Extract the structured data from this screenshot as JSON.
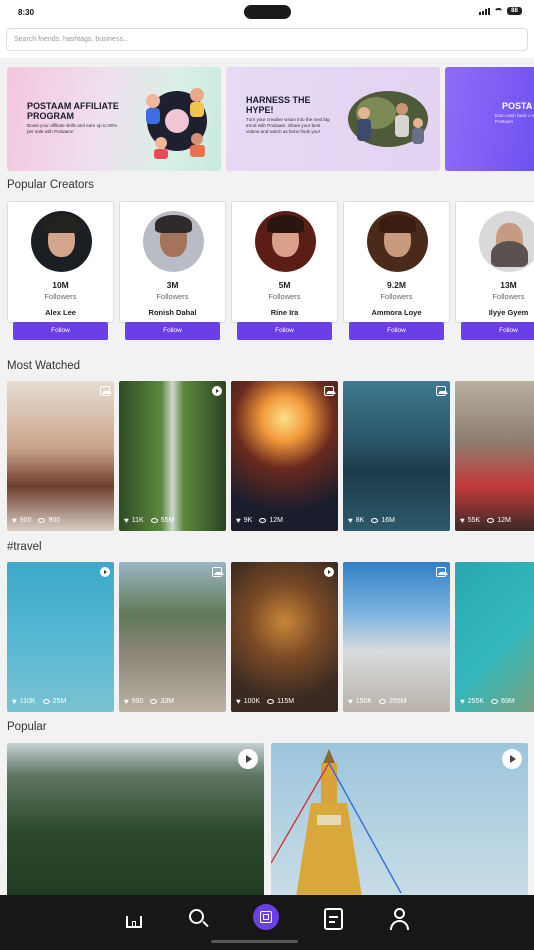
{
  "status": {
    "time": "8:30",
    "battery": "88"
  },
  "search": {
    "placeholder": "Search friends, hashtags, business..."
  },
  "banners": [
    {
      "title": "POSTAAM AFFILIATE PROGRAM",
      "desc": "Boost your affiliate skills and earn up to 80% per sale with Postaam!"
    },
    {
      "title": "HARNESS THE HYPE!",
      "desc": "Turn your creative vision into the next big trend with Postaam. Share your best videos and watch as fame finds you!"
    },
    {
      "title": "POSTA",
      "desc": "Earn cash back o with Postaam"
    }
  ],
  "sections": {
    "creators": "Popular Creators",
    "most_watched": "Most Watched",
    "travel": "#travel",
    "popular": "Popular"
  },
  "creators": [
    {
      "count": "10M",
      "followers_label": "Followers",
      "name": "Alex Lee",
      "button": "Follow"
    },
    {
      "count": "3M",
      "followers_label": "Followers",
      "name": "Ronish Dahal",
      "button": "Follow"
    },
    {
      "count": "5M",
      "followers_label": "Followers",
      "name": "Rine Ira",
      "button": "Follow"
    },
    {
      "count": "9.2M",
      "followers_label": "Followers",
      "name": "Ammora Loye",
      "button": "Follow"
    },
    {
      "count": "13M",
      "followers_label": "Followers",
      "name": "Ilyye Gyem",
      "button": "Follow"
    }
  ],
  "most_watched": [
    {
      "likes": "900",
      "views": "900",
      "icon": "image-icon"
    },
    {
      "likes": "11K",
      "views": "55M",
      "icon": "play-icon"
    },
    {
      "likes": "9K",
      "views": "12M",
      "icon": "image-icon"
    },
    {
      "likes": "8K",
      "views": "16M",
      "icon": "image-icon"
    },
    {
      "likes": "55K",
      "views": "12M",
      "icon": "image-icon"
    }
  ],
  "travel": [
    {
      "likes": "110K",
      "views": "25M",
      "icon": "play-icon"
    },
    {
      "likes": "990",
      "views": "33M",
      "icon": "image-icon"
    },
    {
      "likes": "100K",
      "views": "115M",
      "icon": "play-icon"
    },
    {
      "likes": "150K",
      "views": "255M",
      "icon": "image-icon"
    },
    {
      "likes": "255K",
      "views": "69M",
      "icon": "play-icon"
    }
  ],
  "nav": [
    "home-icon",
    "search-icon",
    "create-post-icon",
    "feed-icon",
    "profile-icon"
  ],
  "colors": {
    "accent": "#6a3fe6",
    "nav_bg": "#171717"
  }
}
